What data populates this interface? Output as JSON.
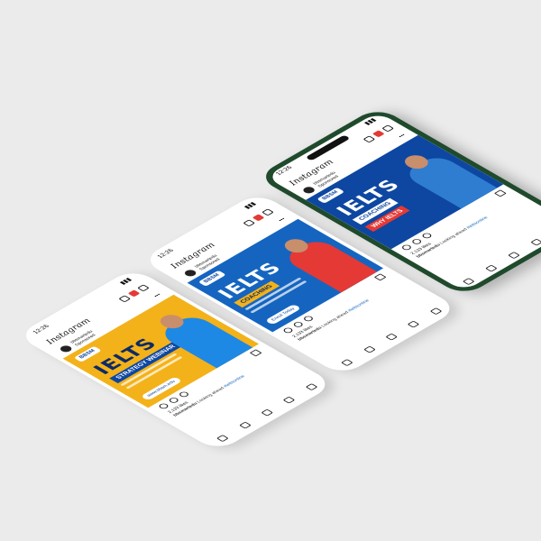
{
  "status": {
    "time": "12:26",
    "signal": "↑"
  },
  "app": {
    "name": "Instagram"
  },
  "account": {
    "name": "bbsmartedu",
    "subtitle": "Sponsored"
  },
  "posts": [
    {
      "badge": "BBSM",
      "headline": "IELTS",
      "subline": "STRATEGY WEBINAR",
      "cta": "www.bbsm.edu",
      "likes": "2,133 likes",
      "caption_user": "bbsmartedu",
      "caption_text": "Looking ahead",
      "hashtag": "#ieltsonline"
    },
    {
      "badge": "BBSM",
      "headline": "IELTS",
      "subline": "COACHING",
      "cta": "Enroll Today",
      "likes": "2,133 likes",
      "caption_user": "bbsmartedu",
      "caption_text": "Looking ahead",
      "hashtag": "#ieltsonline"
    },
    {
      "badge": "BBSM",
      "headline": "IELTS",
      "subline": "COACHING",
      "extra": "WHY IELTS",
      "likes": "2,133 likes",
      "caption_user": "bbsmartedu",
      "caption_text": "Looking ahead",
      "hashtag": "#ieltsonline"
    }
  ],
  "colors": {
    "bg": "#ebebeb",
    "phone_green": "#1f4a2c",
    "ig_red": "#e53935",
    "brand_blue": "#0d47a1",
    "yellow": "#f3b21a"
  },
  "icons": [
    "instagram-logo",
    "add-icon",
    "heart-icon",
    "messenger-icon",
    "comment-icon",
    "share-icon",
    "bookmark-icon",
    "home-icon",
    "search-icon",
    "reels-icon",
    "shop-icon",
    "profile-icon"
  ]
}
